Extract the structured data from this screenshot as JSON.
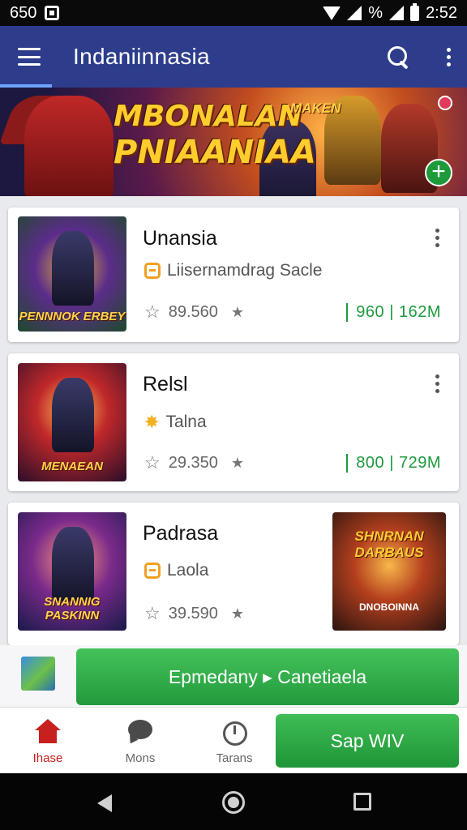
{
  "status_bar": {
    "left_text": "650",
    "signal_text": "%",
    "time": "2:52"
  },
  "app_bar": {
    "title": "Indaniinnasia"
  },
  "banner": {
    "line1": "MBONALAN",
    "line2": "PNIAANIAA",
    "tag": "MAKEN",
    "add_symbol": "+"
  },
  "cards": [
    {
      "title": "Unansia",
      "subtitle": "Liisernamdrag Sacle",
      "rating": "89.560",
      "stat": "960 | 162M",
      "thumb_caption": "PENNNOK ERBEY"
    },
    {
      "title": "Relsl",
      "subtitle": "Talna",
      "rating": "29.350",
      "stat": "800 | 729M",
      "thumb_caption": "MENAEAN"
    },
    {
      "title": "Padrasa",
      "subtitle": "Laola",
      "rating": "39.590",
      "thumb_caption": "SNANNIG PASKINN",
      "side_caption": "SHNRNAN DARBAUS",
      "side_bottom": "DNOBOINNA"
    }
  ],
  "promo": {
    "button_label": "Epmedany ▸ Canetiaela"
  },
  "bottom_nav": {
    "items": [
      {
        "label": "Ihase"
      },
      {
        "label": "Mons"
      },
      {
        "label": "Tarans"
      }
    ],
    "action_label": "Sap WIV"
  },
  "colors": {
    "app_bar": "#2d3d8c",
    "accent_green": "#239a3c",
    "home_red": "#c8201e",
    "stat_green": "#1f9a3e"
  }
}
